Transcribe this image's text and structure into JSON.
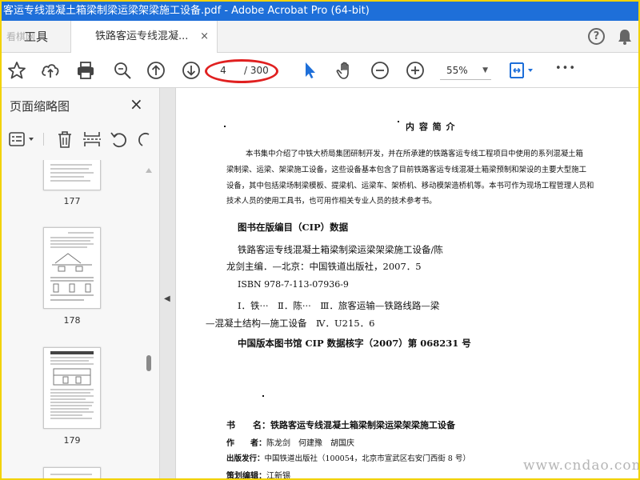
{
  "window": {
    "title": "客运专线混凝土箱梁制梁运梁架梁施工设备.pdf - Adobe Acrobat Pro (64-bit)"
  },
  "tabs": {
    "tools_label": "工具",
    "watermark": "看棋网",
    "doc_label": "铁路客运专线混凝...",
    "close_glyph": "×"
  },
  "header_icons": {
    "help": "?",
    "help_icon": "help-icon",
    "bell_icon": "bell-icon"
  },
  "toolbar": {
    "icons": [
      "star-icon",
      "upload-icon",
      "print-icon",
      "zoom-search-icon",
      "page-up-icon",
      "page-down-icon",
      "select-arrow-icon",
      "hand-icon",
      "zoom-out-icon",
      "zoom-in-icon",
      "fit-page-icon",
      "more-icon"
    ],
    "current_page": "4",
    "total_pages": "/ 300",
    "zoom": "55%",
    "more": "•••",
    "accent": "#1e6fd9"
  },
  "sidebar": {
    "title": "页面缩略图",
    "close": "×",
    "thumbnails": [
      {
        "label": "177"
      },
      {
        "label": "178"
      },
      {
        "label": "179"
      }
    ]
  },
  "document": {
    "heading": "内 容 简 介",
    "intro": [
      "本书集中介绍了中铁大桥局集团研制开发，并在所承建的铁路客运专线工程项目中使用的系列混凝土箱",
      "梁制梁、运梁、架梁施工设备，这些设备基本包含了目前铁路客运专线混凝土箱梁预制和架设的主要大型施工",
      "设备，其中包括梁场制梁模板、提梁机、运梁车、架桥机、移动模架造桥机等。本书可作为现场工程管理人员和",
      "技术人员的使用工具书，也可用作相关专业人员的技术参考书。"
    ],
    "cip_title": "图书在版编目（CIP）数据",
    "cip_lines": [
      "铁路客运专线混凝土箱梁制梁运梁架梁施工设备/陈",
      "龙剑主编．—北京：中国铁道出版社，2007．5",
      "ISBN 978-7-113-07936-9",
      "Ⅰ．铁···　Ⅱ．陈···　Ⅲ．旅客运输—铁路线路—梁",
      "—混凝土结构—施工设备　Ⅳ．U215．6"
    ],
    "cip_number": "中国版本图书馆 CIP 数据核字（2007）第 068231 号",
    "info": [
      {
        "key": "书　　名：",
        "value": "铁路客运专线混凝土箱梁制梁运梁架梁施工设备"
      },
      {
        "key": "作　　者：",
        "value": "陈龙剑　何建豫　胡国庆"
      },
      {
        "key": "出版发行：",
        "value": "中国铁道出版社（100054，北京市宣武区右安门西街 8 号）"
      },
      {
        "key": "策划编辑：",
        "value": "江新锡"
      }
    ]
  },
  "site_watermark": "www.cndao.com"
}
